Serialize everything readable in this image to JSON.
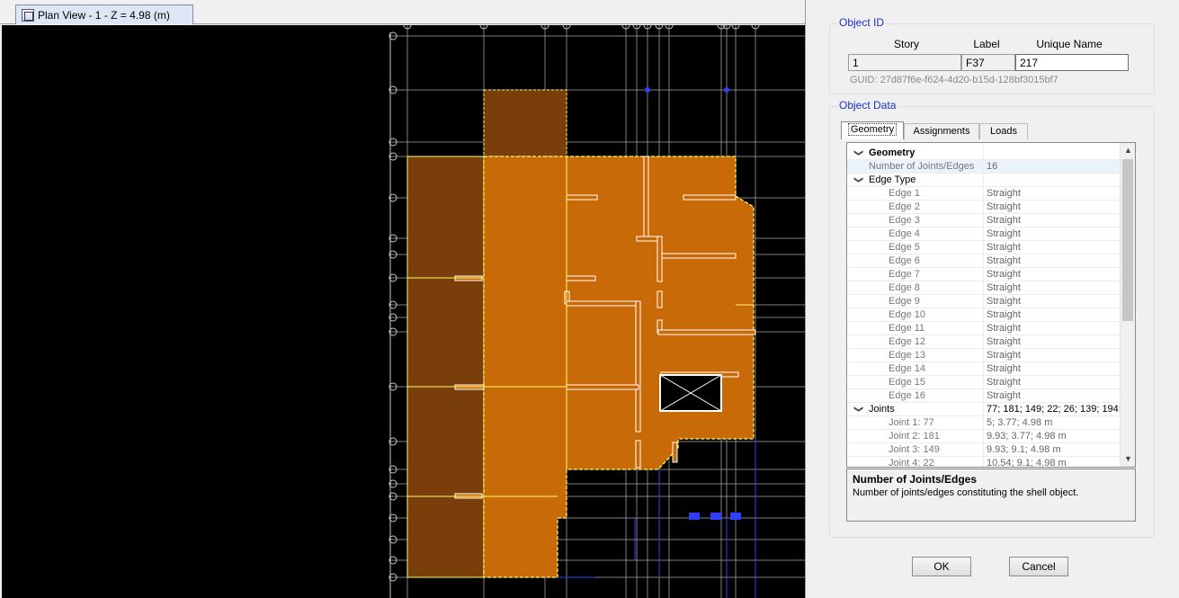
{
  "plan_view": {
    "tab_title": "Plan View - 1 - Z = 4.98 (m)"
  },
  "colors": {
    "background": "#000000",
    "slab_orange": "#c86a08",
    "slab_brown": "#7a3e0a",
    "grid_line": "#a8a8a8",
    "selection_yellow": "#ffff66",
    "beam_blue": "#2f3fff",
    "accent_title": "#1f2fbf"
  },
  "dialog": {
    "object_id": {
      "group_title": "Object ID",
      "headers": [
        "Story",
        "Label",
        "Unique Name"
      ],
      "story": "1",
      "label": "F37",
      "unique_name": "217",
      "guid": "GUID:  27d87f6e-f624-4d20-b15d-128bf3015bf7"
    },
    "object_data": {
      "group_title": "Object Data",
      "tabs": [
        "Geometry",
        "Assignments",
        "Loads"
      ],
      "active_tab": "Geometry",
      "rows": [
        {
          "kind": "header",
          "chevron": "❯",
          "name": "Geometry",
          "value": ""
        },
        {
          "kind": "item",
          "name": "Number of Joints/Edges",
          "value": "16"
        },
        {
          "kind": "cat",
          "chevron": "❯",
          "name": "Edge Type",
          "value": ""
        },
        {
          "kind": "sub",
          "name": "Edge 1",
          "value": "Straight"
        },
        {
          "kind": "sub",
          "name": "Edge 2",
          "value": "Straight"
        },
        {
          "kind": "sub",
          "name": "Edge 3",
          "value": "Straight"
        },
        {
          "kind": "sub",
          "name": "Edge 4",
          "value": "Straight"
        },
        {
          "kind": "sub",
          "name": "Edge 5",
          "value": "Straight"
        },
        {
          "kind": "sub",
          "name": "Edge 6",
          "value": "Straight"
        },
        {
          "kind": "sub",
          "name": "Edge 7",
          "value": "Straight"
        },
        {
          "kind": "sub",
          "name": "Edge 8",
          "value": "Straight"
        },
        {
          "kind": "sub",
          "name": "Edge 9",
          "value": "Straight"
        },
        {
          "kind": "sub",
          "name": "Edge 10",
          "value": "Straight"
        },
        {
          "kind": "sub",
          "name": "Edge 11",
          "value": "Straight"
        },
        {
          "kind": "sub",
          "name": "Edge 12",
          "value": "Straight"
        },
        {
          "kind": "sub",
          "name": "Edge 13",
          "value": "Straight"
        },
        {
          "kind": "sub",
          "name": "Edge 14",
          "value": "Straight"
        },
        {
          "kind": "sub",
          "name": "Edge 15",
          "value": "Straight"
        },
        {
          "kind": "sub",
          "name": "Edge 16",
          "value": "Straight"
        },
        {
          "kind": "cat",
          "chevron": "❯",
          "name": "Joints",
          "value": "77; 181; 149; 22; 26; 139; 194;"
        },
        {
          "kind": "sub",
          "name": "Joint 1: 77",
          "value": "5; 3.77; 4.98 m"
        },
        {
          "kind": "sub",
          "name": "Joint 2: 181",
          "value": "9.93; 3.77; 4.98 m"
        },
        {
          "kind": "sub",
          "name": "Joint 3: 149",
          "value": "9.93; 9.1; 4.98 m"
        },
        {
          "kind": "sub",
          "name": "Joint 4: 22",
          "value": "10.54; 9.1; 4.98 m"
        }
      ],
      "description": {
        "title": "Number of Joints/Edges",
        "text": "Number of joints/edges constituting the shell object."
      }
    },
    "buttons": {
      "ok": "OK",
      "cancel": "Cancel"
    }
  }
}
